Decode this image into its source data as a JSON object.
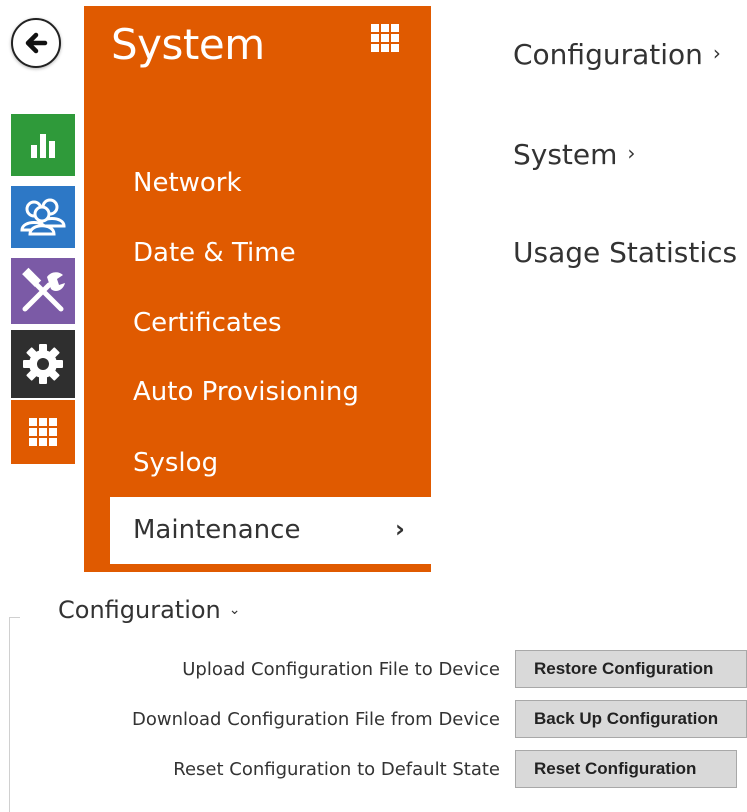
{
  "panel": {
    "title": "System"
  },
  "menu": {
    "items": [
      {
        "label": "Network"
      },
      {
        "label": "Date & Time"
      },
      {
        "label": "Certificates"
      },
      {
        "label": "Auto Provisioning"
      },
      {
        "label": "Syslog"
      }
    ],
    "active": {
      "label": "Maintenance",
      "chevron": "›"
    }
  },
  "links": [
    {
      "label": "Configuration",
      "chevron": "›"
    },
    {
      "label": "System",
      "chevron": "›"
    },
    {
      "label": "Usage Statistics",
      "chevron": "›"
    }
  ],
  "configuration": {
    "heading": "Configuration",
    "caret": "⌄",
    "rows": [
      {
        "label": "Upload Configuration File to Device",
        "button": "Restore Configuration"
      },
      {
        "label": "Download Configuration File from Device",
        "button": "Back Up Configuration"
      },
      {
        "label": "Reset Configuration to Default State",
        "button": "Reset Configuration"
      }
    ]
  },
  "icons": {
    "back": "back-arrow-icon",
    "status": "bar-chart-icon",
    "users": "users-icon",
    "services": "tools-icon",
    "hardware": "gear-icon",
    "system": "grid-icon",
    "apps": "grid-icon"
  },
  "colors": {
    "accent": "#e05a00",
    "status": "#2f9a3a",
    "users": "#2d78c6",
    "services": "#7b5aa6",
    "hardware": "#2f2f2f"
  }
}
